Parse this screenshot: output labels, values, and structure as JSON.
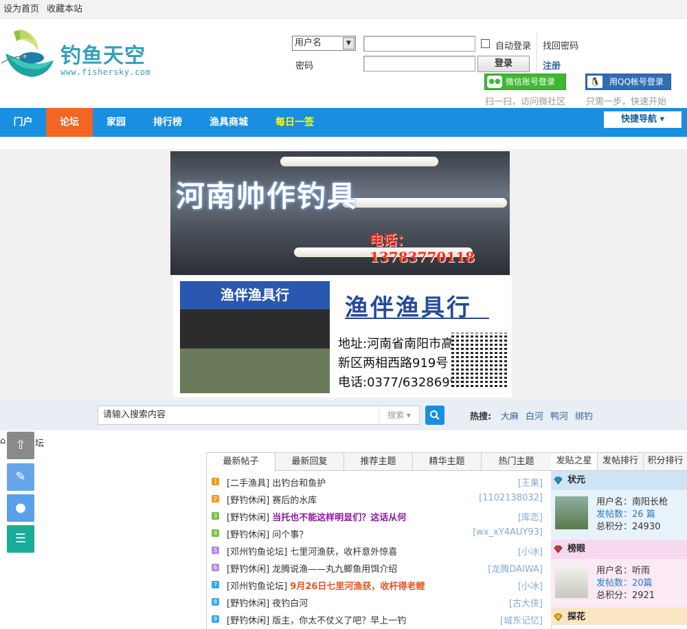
{
  "topbar": {
    "set_home": "设为首页",
    "favorite": "收藏本站"
  },
  "logo": {
    "name": "钓鱼天空",
    "url": "www.fishersky.com"
  },
  "login": {
    "username_select": "用户名",
    "password_label": "密码",
    "auto_login": "自动登录",
    "find_password": "找回密码",
    "login_button": "登录",
    "register": "注册",
    "wechat_button": "微信账号登录",
    "qq_button": "用QQ帐号登录",
    "wechat_tip": "扫一扫，访问微社区",
    "qq_tip": "只需一步，快速开始"
  },
  "nav": {
    "items": [
      {
        "label": "门户"
      },
      {
        "label": "论坛"
      },
      {
        "label": "家园"
      },
      {
        "label": "排行榜"
      },
      {
        "label": "渔具商城"
      },
      {
        "label": "每日一签"
      }
    ],
    "active_index": 1,
    "quick_nav": "快捷导航 ▾"
  },
  "ads": {
    "ad1_title": "河南帅作钓具",
    "ad1_tel": "电话：13783770118",
    "ad2_sign": "渔伴渔具行",
    "ad2_title": "渔伴渔具行",
    "ad2_addr1": "地址:河南省南阳市高",
    "ad2_addr2": "新区两相西路919号",
    "ad2_tel": "电话:0377/63286998"
  },
  "search": {
    "placeholder": "请输入搜索内容",
    "type": "搜索 ▾",
    "hot_label": "热搜:",
    "hot": [
      "大麻",
      "白河",
      "鸭河",
      "绑钓"
    ]
  },
  "breadcrumb": "坛",
  "post_tabs": [
    "最新帖子",
    "最新回复",
    "推荐主题",
    "精华主题",
    "热门主题"
  ],
  "posts": [
    {
      "n": "1",
      "category": "[二手渔具]",
      "title": "出钓台和鱼护",
      "style": "",
      "author": "[王果]"
    },
    {
      "n": "2",
      "category": "[野钓休闲]",
      "title": "赛后的水库",
      "style": "",
      "author": "[1102138032]"
    },
    {
      "n": "3",
      "category": "[野钓休闲]",
      "title": "当托也不能这样明显们？这话从何",
      "style": "purple",
      "author": "[库恋]"
    },
    {
      "n": "4",
      "category": "[野钓休闲]",
      "title": "问个事？",
      "style": "",
      "author": "[wx_xY4AUY93]"
    },
    {
      "n": "5",
      "category": "[邓州钓鱼论坛]",
      "title": "七里河渔获，收杆意外惊喜",
      "style": "",
      "author": "[小冰]"
    },
    {
      "n": "6",
      "category": "[野钓休闲]",
      "title": "龙腾说渔——丸九鲫鱼用饵介绍",
      "style": "",
      "author": "[龙腾DAIWA]"
    },
    {
      "n": "7",
      "category": "[邓州钓鱼论坛]",
      "title": "9月26日七里河渔获，收杆得老鲤",
      "style": "red",
      "author": "[小冰]"
    },
    {
      "n": "8",
      "category": "[野钓休闲]",
      "title": "夜钓白河",
      "style": "",
      "author": "[古大侠]"
    },
    {
      "n": "9",
      "category": "[野钓休闲]",
      "title": "版主，你太不仗义了吧？早上一钓",
      "style": "",
      "author": "[城东记忆]"
    }
  ],
  "rank_tabs": [
    "发贴之星",
    "发帖排行",
    "积分排行"
  ],
  "ranks": [
    {
      "title": "状元",
      "name_label": "用户名：",
      "name": "南阳长枪",
      "posts_label": "发帖数：",
      "posts": "26 篇",
      "score_label": "总积分：",
      "score": "24930",
      "color": "#cfe4f5"
    },
    {
      "title": "榜眼",
      "name_label": "用户名：",
      "name": "听雨",
      "posts_label": "发帖数：",
      "posts": "20篇",
      "score_label": "总积分：",
      "score": "2921",
      "color": "#f7d9ef"
    },
    {
      "title": "探花",
      "color": "#fbe6c3"
    }
  ],
  "colors": {
    "nav_bg": "#1a8ee0",
    "nav_active": "#f26522",
    "accent_link": "#336699"
  }
}
